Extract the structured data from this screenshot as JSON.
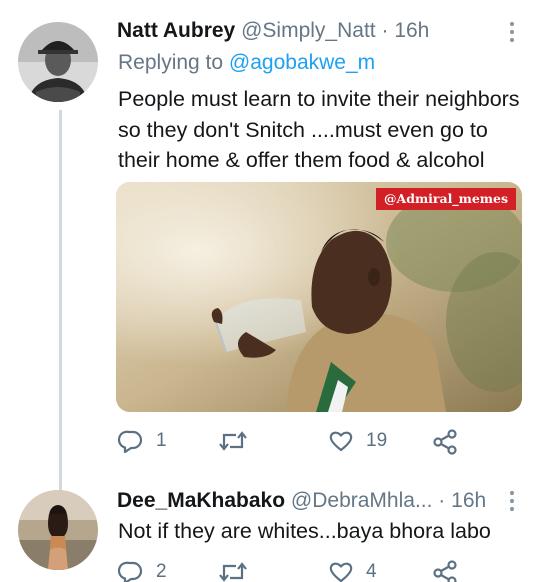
{
  "tweets": [
    {
      "display_name": "Natt Aubrey",
      "handle": "@Simply_Natt",
      "separator": "·",
      "time": "16h",
      "replying_prefix": "Replying to",
      "replying_to": "@agobakwe_m",
      "text_lines": [
        "People must learn to invite their neighbors",
        "so they don't Snitch ....must even go to",
        "their home & offer them food & alcohol"
      ],
      "media": {
        "watermark": "@Admiral_memes"
      },
      "actions": {
        "reply_count": "1",
        "retweet_count": "",
        "like_count": "19"
      }
    },
    {
      "display_name": "Dee_MaKhabako",
      "handle": "@DebraMhla...",
      "separator": "·",
      "time": "16h",
      "text_lines": [
        "Not if they are whites...baya bhora labo"
      ],
      "actions": {
        "reply_count": "2",
        "retweet_count": "",
        "like_count": "4"
      }
    }
  ],
  "icons": {
    "more": "more-vertical-icon",
    "reply": "reply-icon",
    "retweet": "retweet-icon",
    "like": "heart-icon",
    "share": "share-icon"
  },
  "colors": {
    "text": "#14171a",
    "secondary": "#657786",
    "link": "#1da1f2",
    "thread_line": "#cfd9de",
    "watermark_bg": "#d32027"
  }
}
